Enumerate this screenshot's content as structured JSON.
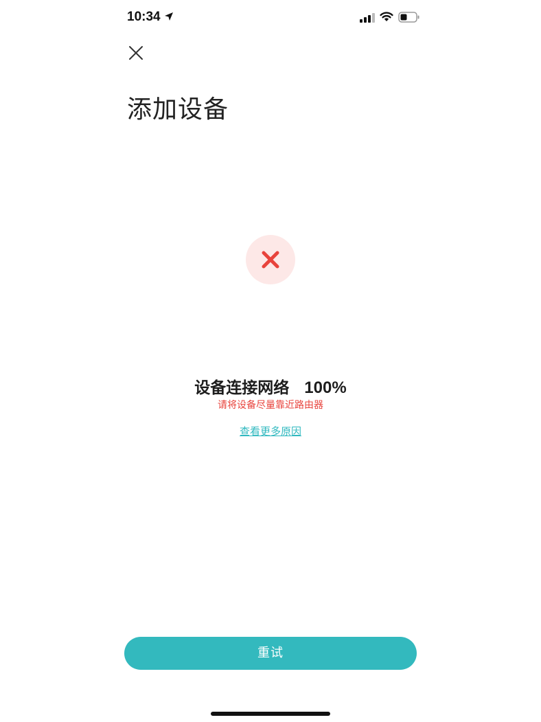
{
  "status_bar": {
    "time": "10:34",
    "icons": [
      "location-arrow-icon",
      "signal-icon",
      "wifi-icon",
      "battery-icon"
    ]
  },
  "header": {
    "close_icon": "close-icon",
    "title": "添加设备"
  },
  "result": {
    "icon": "error-x-icon",
    "status_label": "设备连接网络",
    "progress_text": "100%",
    "progress": 1.0,
    "hint": "请将设备尽量靠近路由器",
    "more_link": "查看更多原因"
  },
  "footer": {
    "retry_label": "重试"
  },
  "colors": {
    "accent": "#33b9be",
    "error": "#e8433c",
    "error_bg": "#fde8e7",
    "link": "#2fb8bf"
  }
}
